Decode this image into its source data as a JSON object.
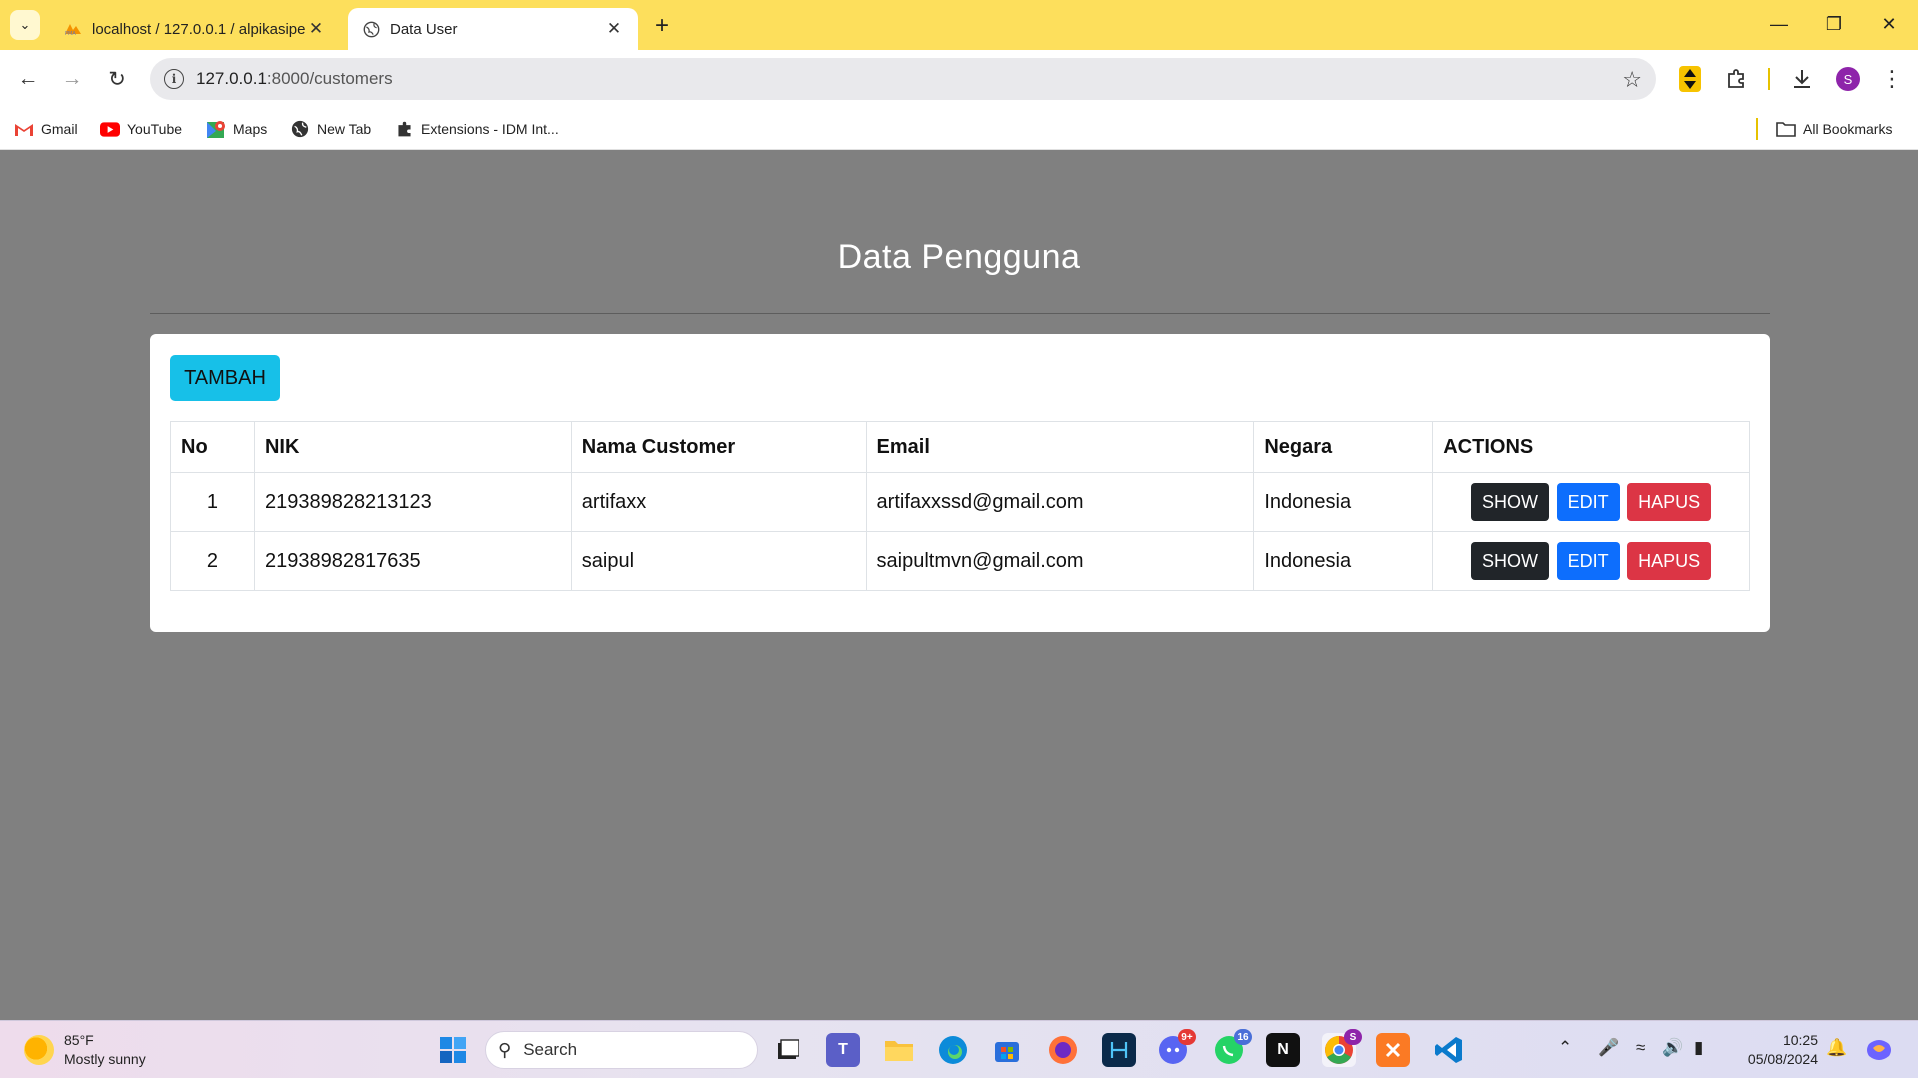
{
  "browser": {
    "tabs": [
      {
        "title": "localhost / 127.0.0.1 / alpikasipe",
        "icon": "phpmyadmin-icon",
        "active": false
      },
      {
        "title": "Data User",
        "icon": "globe-icon",
        "active": true
      }
    ],
    "url_host": "127.0.0.1",
    "url_rest": ":8000/customers",
    "bookmarks": [
      {
        "label": "Gmail",
        "icon": "gmail-icon"
      },
      {
        "label": "YouTube",
        "icon": "youtube-icon"
      },
      {
        "label": "Maps",
        "icon": "maps-icon"
      },
      {
        "label": "New Tab",
        "icon": "globe-icon"
      },
      {
        "label": "Extensions - IDM Int...",
        "icon": "puzzle-icon"
      }
    ],
    "all_bookmarks": "All Bookmarks",
    "profile_initial": "S"
  },
  "page": {
    "title": "Data Pengguna",
    "add_button": "TAMBAH",
    "table": {
      "headers": [
        "No",
        "NIK",
        "Nama Customer",
        "Email",
        "Negara",
        "ACTIONS"
      ],
      "rows": [
        {
          "no": "1",
          "nik": "219389828213123",
          "nama": "artifaxx",
          "email": "artifaxxssd@gmail.com",
          "negara": "Indonesia"
        },
        {
          "no": "2",
          "nik": "21938982817635",
          "nama": "saipul",
          "email": "saipultmvn@gmail.com",
          "negara": "Indonesia"
        }
      ],
      "actions": {
        "show": "SHOW",
        "edit": "EDIT",
        "hapus": "HAPUS"
      }
    }
  },
  "taskbar": {
    "weather_temp": "85°F",
    "weather_desc": "Mostly sunny",
    "search_placeholder": "Search",
    "discord_badge": "9+",
    "whatsapp_badge": "16",
    "chrome_badge": "S",
    "time": "10:25",
    "date": "05/08/2024"
  },
  "colors": {
    "tabstrip": "#fddf5c",
    "page_bg": "#808080",
    "tambah": "#17c0e8",
    "show": "#212529",
    "edit": "#0d6efd",
    "hapus": "#dc3545"
  }
}
